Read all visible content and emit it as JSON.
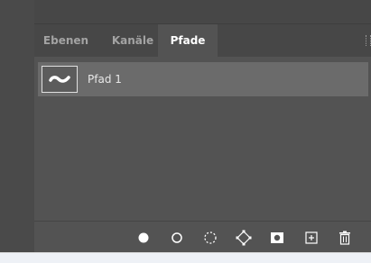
{
  "tabs": [
    {
      "label": "Ebenen",
      "active": false
    },
    {
      "label": "Kanäle",
      "active": false
    },
    {
      "label": "Pfade",
      "active": true
    }
  ],
  "paths": [
    {
      "label": "Pfad 1",
      "selected": true
    }
  ],
  "footer_buttons": [
    {
      "icon": "fill-path-icon",
      "action": "fill"
    },
    {
      "icon": "stroke-path-icon",
      "action": "stroke"
    },
    {
      "icon": "load-selection-icon",
      "action": "selection"
    },
    {
      "icon": "make-work-path-icon",
      "action": "work-path"
    },
    {
      "icon": "add-mask-icon",
      "action": "mask"
    },
    {
      "icon": "new-path-icon",
      "action": "new"
    },
    {
      "icon": "delete-icon",
      "action": "delete"
    }
  ],
  "colors": {
    "panel_bg": "#535353",
    "tab_bg": "#474747",
    "row_selected": "#6b6b6b",
    "text_active": "#ffffff",
    "text_inactive": "#a3a3a3"
  }
}
